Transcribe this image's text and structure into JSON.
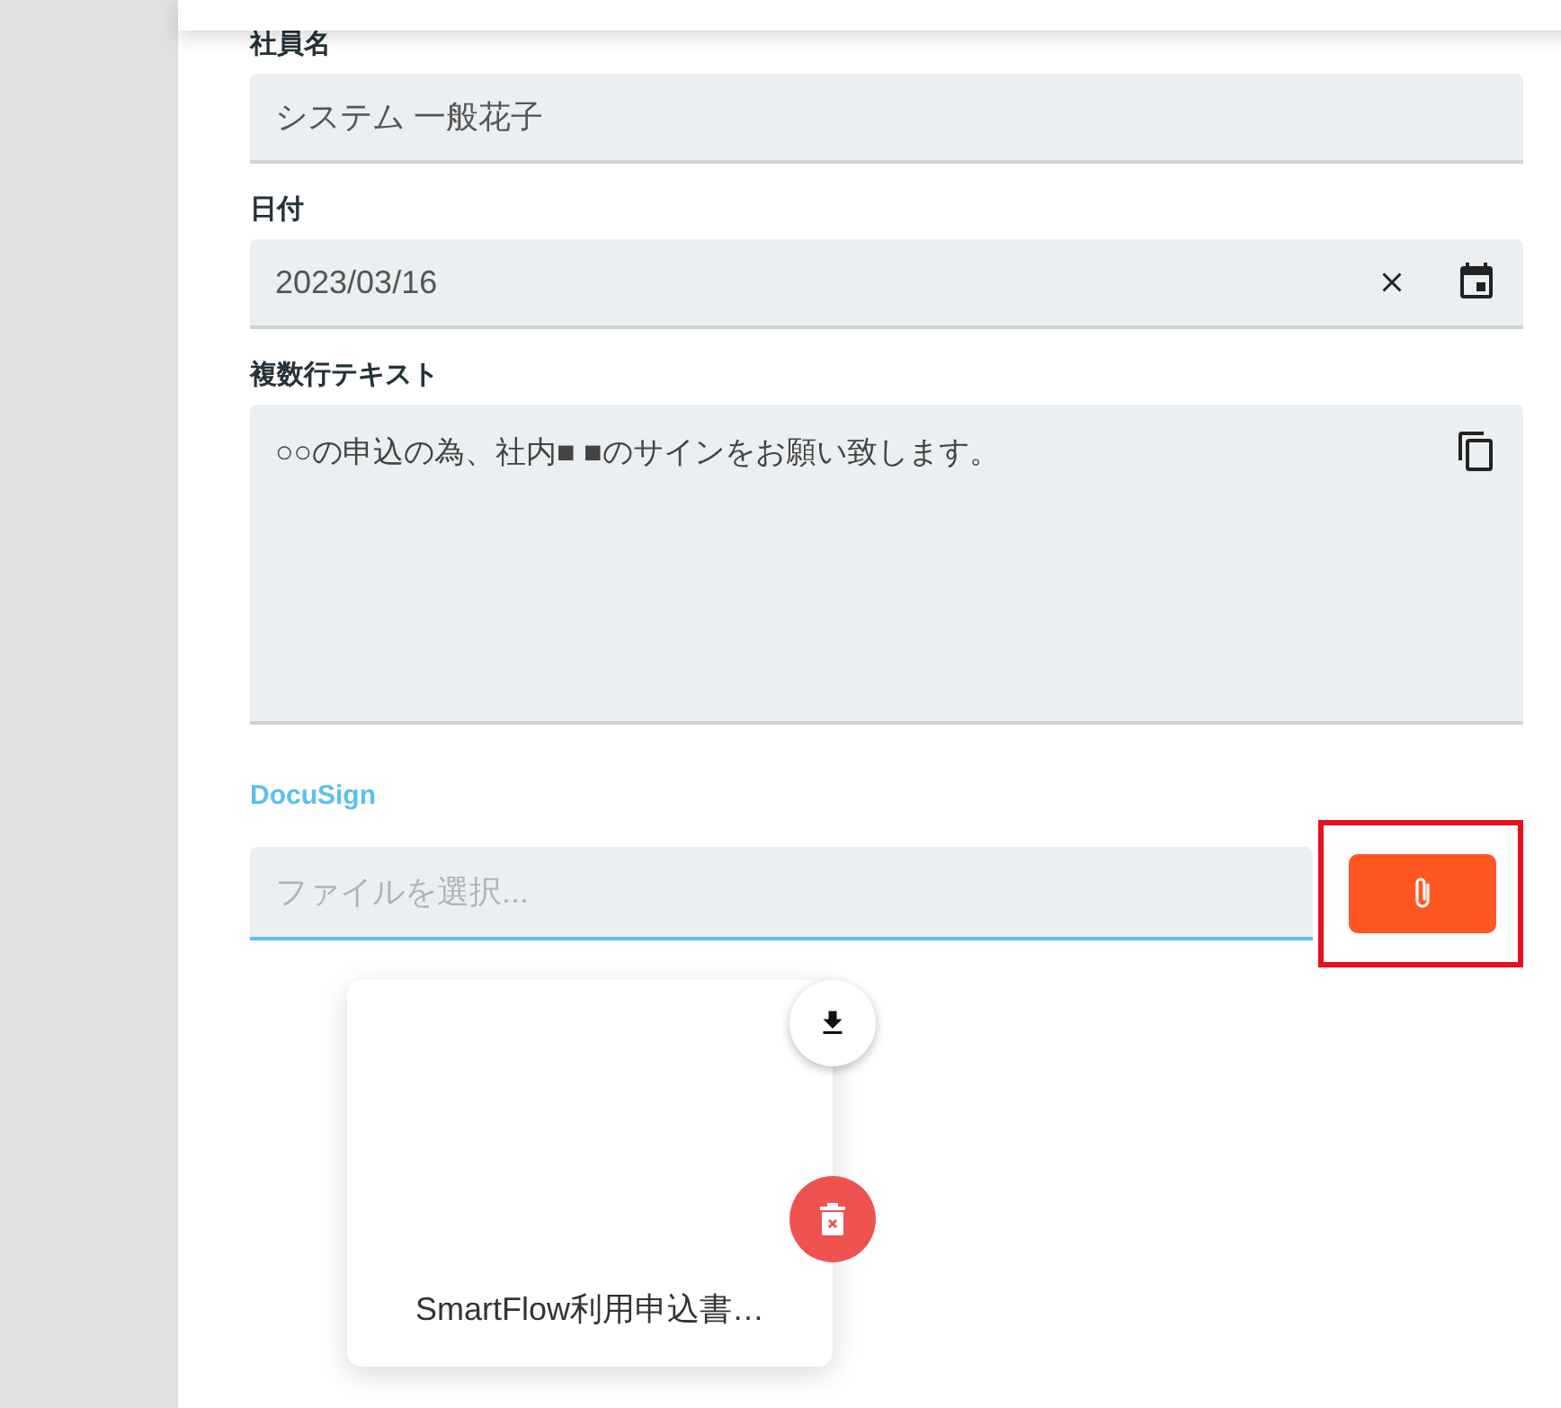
{
  "fields": [
    {
      "kind": "text",
      "label": "社員名",
      "value": "システム 一般花子"
    },
    {
      "kind": "date",
      "label": "日付",
      "value": "2023/03/16"
    },
    {
      "kind": "multiline",
      "label": "複数行テキスト",
      "value": "○○の申込の為、社内■ ■のサインをお願い致します。"
    }
  ],
  "file_field": {
    "label": "DocuSign",
    "placeholder": "ファイルを選択...",
    "focused": true,
    "highlighted": true
  },
  "attachments": [
    {
      "name": "SmartFlow利用申込書…"
    }
  ]
}
